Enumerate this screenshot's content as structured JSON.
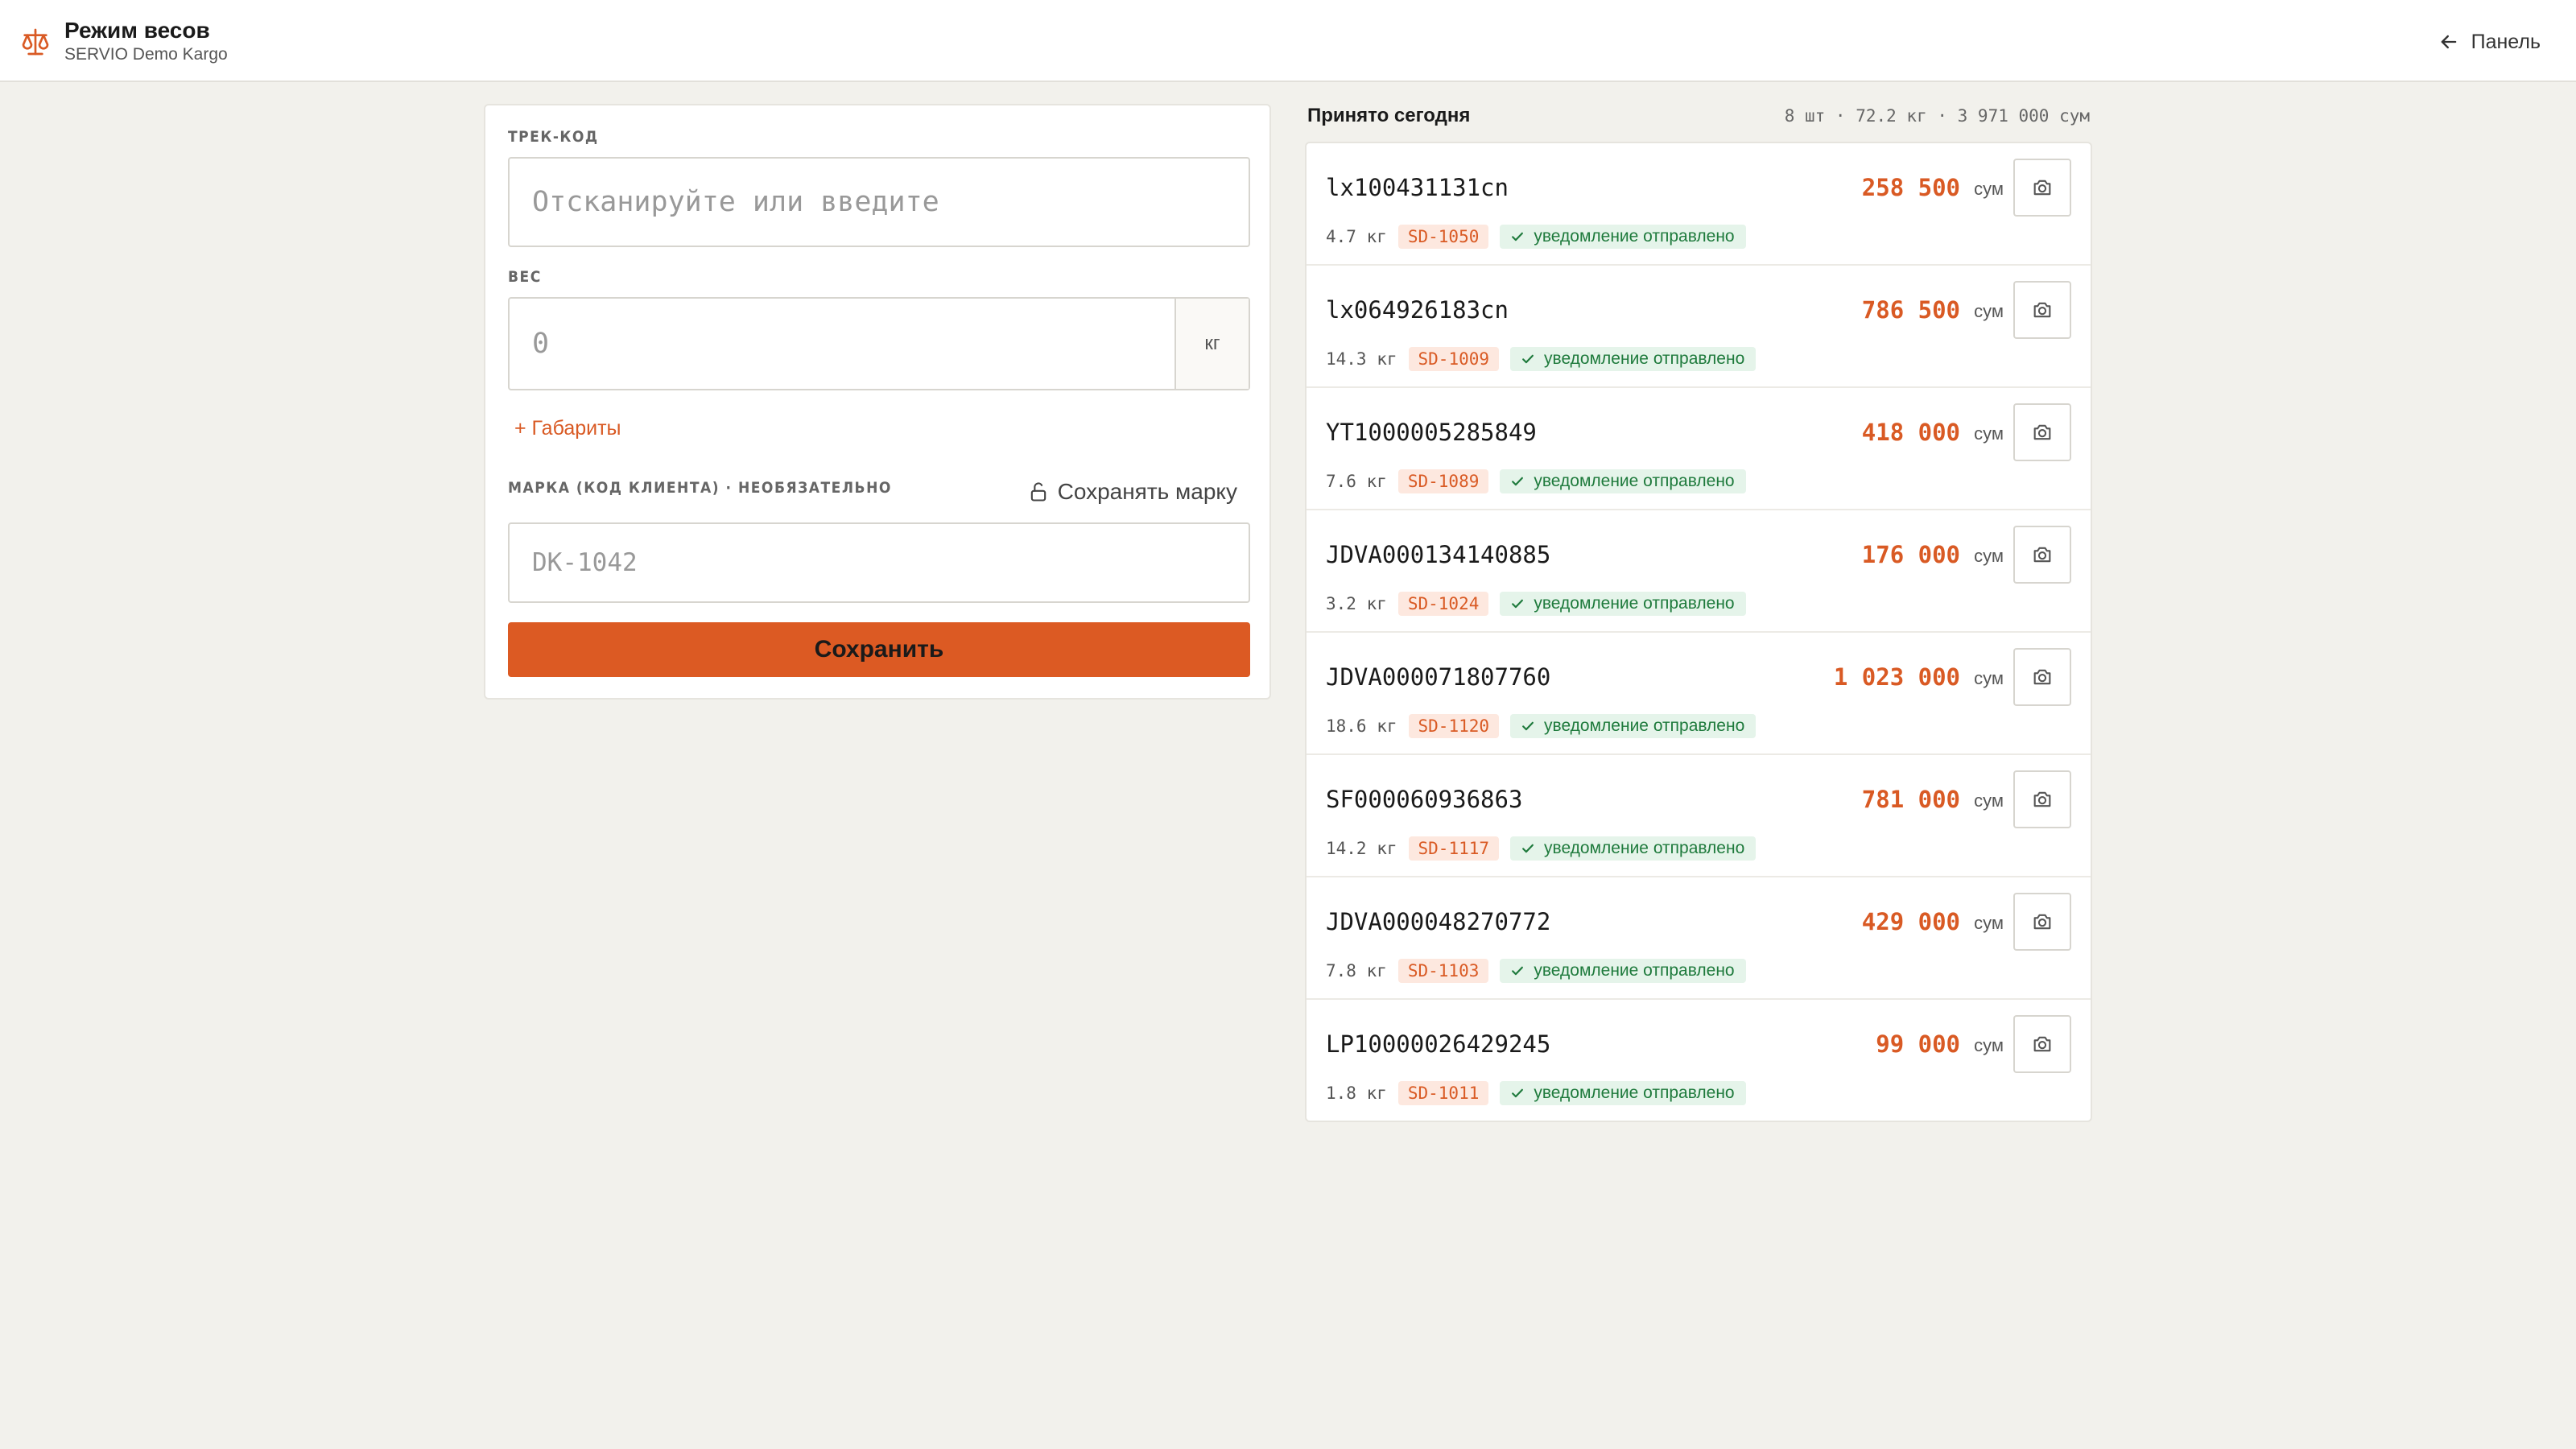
{
  "header": {
    "title": "Режим весов",
    "subtitle": "SERVIO Demo Kargo",
    "back_label": "Панель"
  },
  "form": {
    "track_label": "ТРЕК-КОД",
    "track_placeholder": "Отсканируйте или введите",
    "weight_label": "ВЕС",
    "weight_placeholder": "0",
    "weight_unit": "кг",
    "dimensions_link": "+ Габариты",
    "mark_label": "МАРКА (КОД КЛИЕНТА) · НЕОБЯЗАТЕЛЬНО",
    "keep_mark_label": "Сохранять марку",
    "mark_placeholder": "DK-1042",
    "save_label": "Сохранить"
  },
  "list": {
    "title": "Принято сегодня",
    "summary": "8 шт · 72.2 кг · 3 971 000 сум",
    "currency": "сум",
    "items": [
      {
        "track": "lx100431131cn",
        "price": "258 500",
        "weight": "4.7 кг",
        "client": "SD-1050",
        "status": "уведомление отправлено"
      },
      {
        "track": "lx064926183cn",
        "price": "786 500",
        "weight": "14.3 кг",
        "client": "SD-1009",
        "status": "уведомление отправлено"
      },
      {
        "track": "YT1000005285849",
        "price": "418 000",
        "weight": "7.6 кг",
        "client": "SD-1089",
        "status": "уведомление отправлено"
      },
      {
        "track": "JDVA000134140885",
        "price": "176 000",
        "weight": "3.2 кг",
        "client": "SD-1024",
        "status": "уведомление отправлено"
      },
      {
        "track": "JDVA000071807760",
        "price": "1 023 000",
        "weight": "18.6 кг",
        "client": "SD-1120",
        "status": "уведомление отправлено"
      },
      {
        "track": "SF000060936863",
        "price": "781 000",
        "weight": "14.2 кг",
        "client": "SD-1117",
        "status": "уведомление отправлено"
      },
      {
        "track": "JDVA000048270772",
        "price": "429 000",
        "weight": "7.8 кг",
        "client": "SD-1103",
        "status": "уведомление отправлено"
      },
      {
        "track": "LP10000026429245",
        "price": "99 000",
        "weight": "1.8 кг",
        "client": "SD-1011",
        "status": "уведомление отправлено"
      }
    ]
  },
  "colors": {
    "accent": "#dc5a23",
    "success": "#1e7a3c",
    "background": "#f2f1ec"
  },
  "icons": {
    "brand": "scales-icon",
    "back": "arrow-left-icon",
    "lock": "unlock-icon",
    "photo": "camera-icon",
    "status": "check-icon"
  }
}
